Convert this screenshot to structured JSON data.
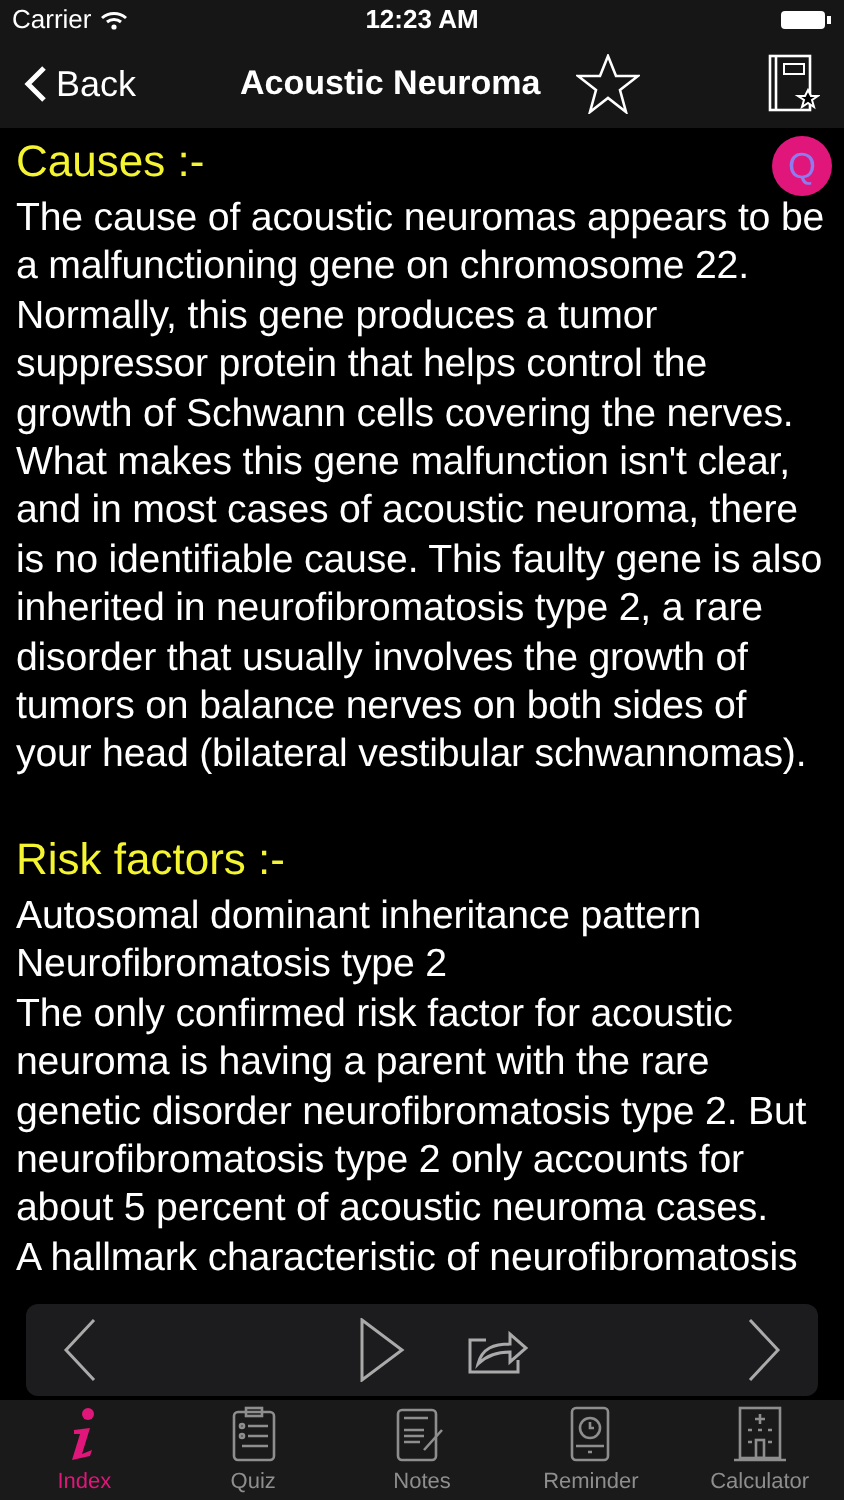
{
  "status_bar": {
    "carrier": "Carrier",
    "time": "12:23 AM"
  },
  "nav": {
    "back": "Back",
    "title": "Acoustic Neuroma"
  },
  "quiz_badge": "Q",
  "sections": [
    {
      "heading": "Causes :-",
      "paragraphs": [
        "The cause of acoustic neuromas appears to be a malfunctioning gene on chromosome 22. Normally, this gene produces a tumor suppressor protein that helps control the growth of Schwann cells covering the nerves. What makes this gene malfunction isn't clear, and in most cases of acoustic neuroma, there is no identifiable cause. This faulty gene is also inherited in neurofibromatosis type 2, a rare disorder that usually involves the growth of tumors on balance nerves on both sides of your head (bilateral vestibular schwannomas)."
      ]
    },
    {
      "heading": "Risk factors :-",
      "paragraphs": [
        "Autosomal dominant inheritance pattern",
        "Neurofibromatosis type 2",
        "The only confirmed risk factor for acoustic neuroma is having a parent with the rare genetic disorder neurofibromatosis type 2. But neurofibromatosis type 2 only accounts for about 5 percent of acoustic neuroma cases.",
        "A hallmark characteristic of neurofibromatosis"
      ]
    }
  ],
  "tabs": [
    {
      "label": "Index",
      "kind": "index",
      "selected": true
    },
    {
      "label": "Quiz",
      "kind": "quiz",
      "selected": false
    },
    {
      "label": "Notes",
      "kind": "notes",
      "selected": false
    },
    {
      "label": "Reminder",
      "kind": "reminder",
      "selected": false
    },
    {
      "label": "Calculator",
      "kind": "calculator",
      "selected": false
    }
  ]
}
